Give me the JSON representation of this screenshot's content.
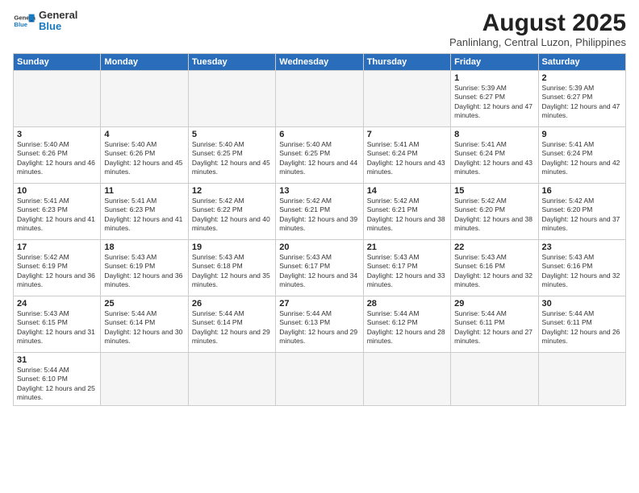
{
  "header": {
    "logo_general": "General",
    "logo_blue": "Blue",
    "month_year": "August 2025",
    "location": "Panlinlang, Central Luzon, Philippines"
  },
  "days_of_week": [
    "Sunday",
    "Monday",
    "Tuesday",
    "Wednesday",
    "Thursday",
    "Friday",
    "Saturday"
  ],
  "weeks": [
    [
      {
        "day": "",
        "empty": true
      },
      {
        "day": "",
        "empty": true
      },
      {
        "day": "",
        "empty": true
      },
      {
        "day": "",
        "empty": true
      },
      {
        "day": "",
        "empty": true
      },
      {
        "day": "1",
        "sunrise": "5:39 AM",
        "sunset": "6:27 PM",
        "daylight": "12 hours and 47 minutes."
      },
      {
        "day": "2",
        "sunrise": "5:39 AM",
        "sunset": "6:27 PM",
        "daylight": "12 hours and 47 minutes."
      }
    ],
    [
      {
        "day": "3",
        "sunrise": "5:40 AM",
        "sunset": "6:26 PM",
        "daylight": "12 hours and 46 minutes."
      },
      {
        "day": "4",
        "sunrise": "5:40 AM",
        "sunset": "6:26 PM",
        "daylight": "12 hours and 45 minutes."
      },
      {
        "day": "5",
        "sunrise": "5:40 AM",
        "sunset": "6:25 PM",
        "daylight": "12 hours and 45 minutes."
      },
      {
        "day": "6",
        "sunrise": "5:40 AM",
        "sunset": "6:25 PM",
        "daylight": "12 hours and 44 minutes."
      },
      {
        "day": "7",
        "sunrise": "5:41 AM",
        "sunset": "6:24 PM",
        "daylight": "12 hours and 43 minutes."
      },
      {
        "day": "8",
        "sunrise": "5:41 AM",
        "sunset": "6:24 PM",
        "daylight": "12 hours and 43 minutes."
      },
      {
        "day": "9",
        "sunrise": "5:41 AM",
        "sunset": "6:24 PM",
        "daylight": "12 hours and 42 minutes."
      }
    ],
    [
      {
        "day": "10",
        "sunrise": "5:41 AM",
        "sunset": "6:23 PM",
        "daylight": "12 hours and 41 minutes."
      },
      {
        "day": "11",
        "sunrise": "5:41 AM",
        "sunset": "6:23 PM",
        "daylight": "12 hours and 41 minutes."
      },
      {
        "day": "12",
        "sunrise": "5:42 AM",
        "sunset": "6:22 PM",
        "daylight": "12 hours and 40 minutes."
      },
      {
        "day": "13",
        "sunrise": "5:42 AM",
        "sunset": "6:21 PM",
        "daylight": "12 hours and 39 minutes."
      },
      {
        "day": "14",
        "sunrise": "5:42 AM",
        "sunset": "6:21 PM",
        "daylight": "12 hours and 38 minutes."
      },
      {
        "day": "15",
        "sunrise": "5:42 AM",
        "sunset": "6:20 PM",
        "daylight": "12 hours and 38 minutes."
      },
      {
        "day": "16",
        "sunrise": "5:42 AM",
        "sunset": "6:20 PM",
        "daylight": "12 hours and 37 minutes."
      }
    ],
    [
      {
        "day": "17",
        "sunrise": "5:42 AM",
        "sunset": "6:19 PM",
        "daylight": "12 hours and 36 minutes."
      },
      {
        "day": "18",
        "sunrise": "5:43 AM",
        "sunset": "6:19 PM",
        "daylight": "12 hours and 36 minutes."
      },
      {
        "day": "19",
        "sunrise": "5:43 AM",
        "sunset": "6:18 PM",
        "daylight": "12 hours and 35 minutes."
      },
      {
        "day": "20",
        "sunrise": "5:43 AM",
        "sunset": "6:17 PM",
        "daylight": "12 hours and 34 minutes."
      },
      {
        "day": "21",
        "sunrise": "5:43 AM",
        "sunset": "6:17 PM",
        "daylight": "12 hours and 33 minutes."
      },
      {
        "day": "22",
        "sunrise": "5:43 AM",
        "sunset": "6:16 PM",
        "daylight": "12 hours and 32 minutes."
      },
      {
        "day": "23",
        "sunrise": "5:43 AM",
        "sunset": "6:16 PM",
        "daylight": "12 hours and 32 minutes."
      }
    ],
    [
      {
        "day": "24",
        "sunrise": "5:43 AM",
        "sunset": "6:15 PM",
        "daylight": "12 hours and 31 minutes."
      },
      {
        "day": "25",
        "sunrise": "5:44 AM",
        "sunset": "6:14 PM",
        "daylight": "12 hours and 30 minutes."
      },
      {
        "day": "26",
        "sunrise": "5:44 AM",
        "sunset": "6:14 PM",
        "daylight": "12 hours and 29 minutes."
      },
      {
        "day": "27",
        "sunrise": "5:44 AM",
        "sunset": "6:13 PM",
        "daylight": "12 hours and 29 minutes."
      },
      {
        "day": "28",
        "sunrise": "5:44 AM",
        "sunset": "6:12 PM",
        "daylight": "12 hours and 28 minutes."
      },
      {
        "day": "29",
        "sunrise": "5:44 AM",
        "sunset": "6:11 PM",
        "daylight": "12 hours and 27 minutes."
      },
      {
        "day": "30",
        "sunrise": "5:44 AM",
        "sunset": "6:11 PM",
        "daylight": "12 hours and 26 minutes."
      }
    ],
    [
      {
        "day": "31",
        "sunrise": "5:44 AM",
        "sunset": "6:10 PM",
        "daylight": "12 hours and 25 minutes."
      },
      {
        "day": "",
        "empty": true
      },
      {
        "day": "",
        "empty": true
      },
      {
        "day": "",
        "empty": true
      },
      {
        "day": "",
        "empty": true
      },
      {
        "day": "",
        "empty": true
      },
      {
        "day": "",
        "empty": true
      }
    ]
  ]
}
